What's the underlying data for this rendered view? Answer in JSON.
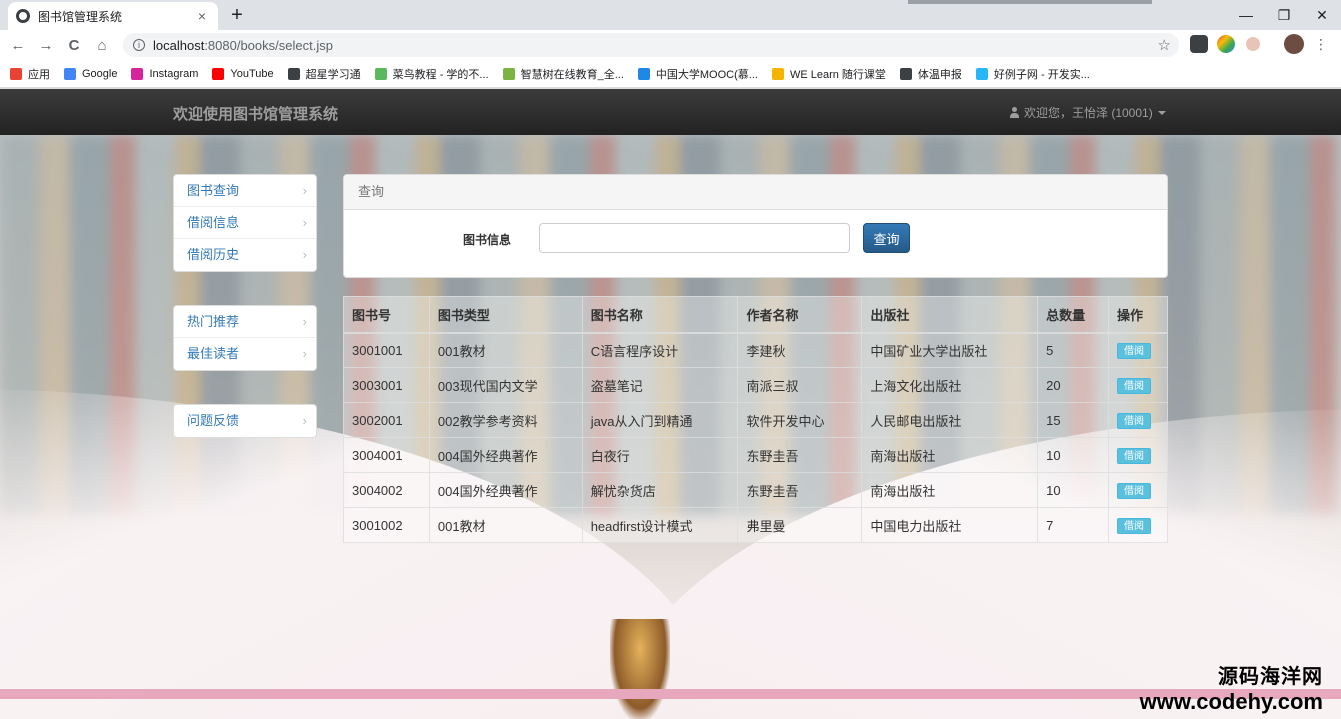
{
  "browser": {
    "tab_title": "图书馆管理系统",
    "tab_close": "×",
    "new_tab": "+",
    "url_host": "localhost",
    "url_path": ":8080/books/select.jsp",
    "nav_back": "←",
    "nav_forward": "→",
    "nav_reload": "C",
    "nav_home": "⌂",
    "star": "☆",
    "window_min": "—",
    "window_max": "❐",
    "window_close": "✕",
    "bookmarks": [
      {
        "label": "应用",
        "color": "#e94235"
      },
      {
        "label": "Google",
        "color": "#4285f4"
      },
      {
        "label": "Instagram",
        "color": "#d6249f"
      },
      {
        "label": "YouTube",
        "color": "#ff0000"
      },
      {
        "label": "超星学习通",
        "color": "#3c4043"
      },
      {
        "label": "菜鸟教程 - 学的不...",
        "color": "#5cb85c"
      },
      {
        "label": "智慧树在线教育_全...",
        "color": "#7cb342"
      },
      {
        "label": "中国大学MOOC(慕...",
        "color": "#1e88e5"
      },
      {
        "label": "WE Learn 随行课堂",
        "color": "#f4b400"
      },
      {
        "label": "体温申报",
        "color": "#3c4043"
      },
      {
        "label": "好例子网 - 开发实...",
        "color": "#29b6f6"
      }
    ]
  },
  "header": {
    "brand": "欢迎使用图书馆管理系统",
    "user": "欢迎您，王怡泽 (10001)"
  },
  "sidebar": {
    "group1": [
      {
        "label": "图书查询"
      },
      {
        "label": "借阅信息"
      },
      {
        "label": "借阅历史"
      }
    ],
    "group2": [
      {
        "label": "热门推荐"
      },
      {
        "label": "最佳读者"
      }
    ],
    "group3": [
      {
        "label": "问题反馈"
      }
    ],
    "chevron": "›"
  },
  "search": {
    "panel_title": "查询",
    "label": "图书信息",
    "value": "",
    "button": "查询"
  },
  "table": {
    "headers": [
      "图书号",
      "图书类型",
      "图书名称",
      "作者名称",
      "出版社",
      "总数量",
      "操作"
    ],
    "borrow_label": "借阅",
    "rows": [
      [
        "3001001",
        "001教材",
        "C语言程序设计",
        "李建秋",
        "中国矿业大学出版社",
        "5"
      ],
      [
        "3003001",
        "003现代国内文学",
        "盗墓笔记",
        "南派三叔",
        "上海文化出版社",
        "20"
      ],
      [
        "3002001",
        "002教学参考资料",
        "java从入门到精通",
        "软件开发中心",
        "人民邮电出版社",
        "15"
      ],
      [
        "3004001",
        "004国外经典著作",
        "白夜行",
        "东野圭吾",
        "南海出版社",
        "10"
      ],
      [
        "3004002",
        "004国外经典著作",
        "解忧杂货店",
        "东野圭吾",
        "南海出版社",
        "10"
      ],
      [
        "3001002",
        "001教材",
        "headfirst设计模式",
        "弗里曼",
        "中国电力出版社",
        "7"
      ]
    ]
  },
  "watermark": {
    "line1": "源码海洋网",
    "line2": "www.codehy.com"
  }
}
